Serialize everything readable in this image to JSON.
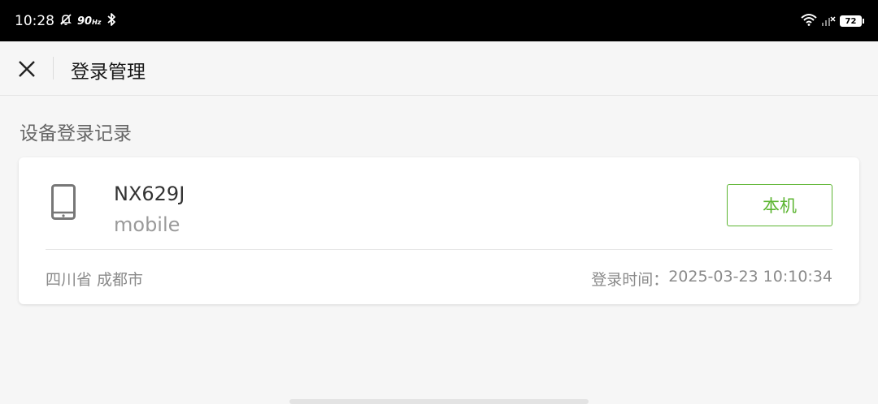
{
  "status_bar": {
    "time": "10:28",
    "refresh_rate": "90",
    "refresh_unit": "Hz",
    "battery": "72"
  },
  "header": {
    "title": "登录管理"
  },
  "section": {
    "title": "设备登录记录"
  },
  "device": {
    "name": "NX629J",
    "type": "mobile",
    "current_label": "本机",
    "location": "四川省 成都市",
    "login_time_label": "登录时间：",
    "login_time": "2025-03-23 10:10:34"
  },
  "colors": {
    "accent": "#5cb531",
    "background": "#f6f6f6",
    "card": "#ffffff"
  }
}
